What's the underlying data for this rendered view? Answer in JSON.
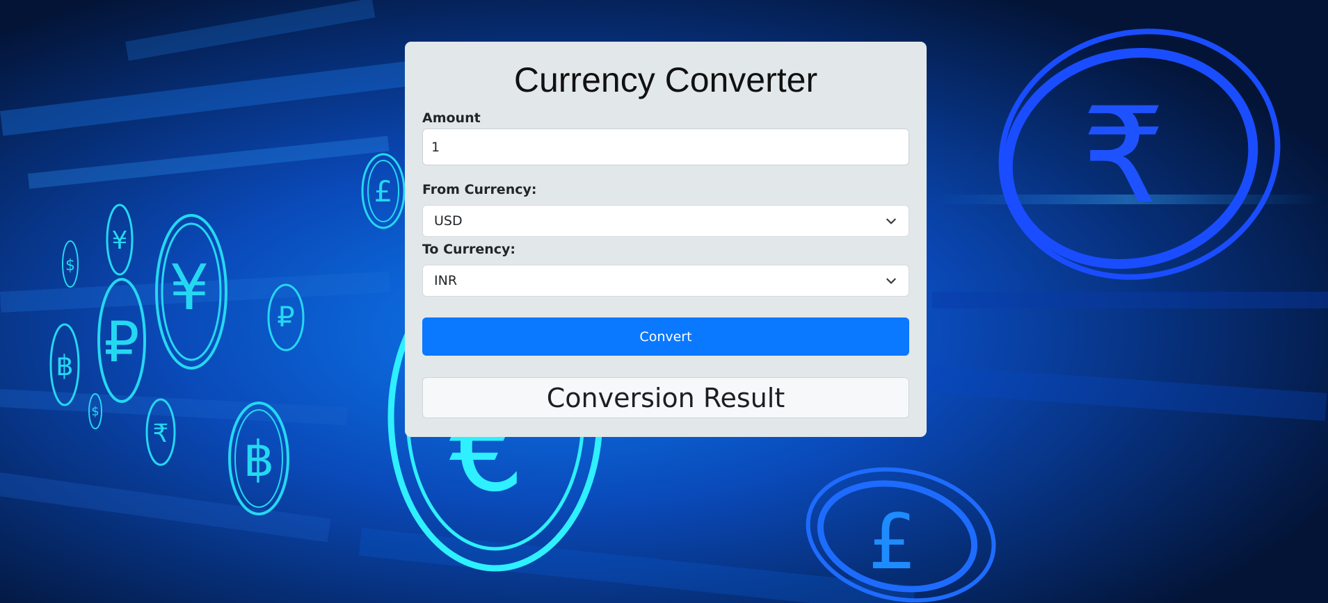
{
  "converter": {
    "title": "Currency Converter",
    "amount": {
      "label": "Amount",
      "value": "1"
    },
    "from_currency": {
      "label": "From Currency:",
      "selected": "USD"
    },
    "to_currency": {
      "label": "To Currency:",
      "selected": "INR"
    },
    "convert_label": "Convert",
    "result_heading": "Conversion Result"
  },
  "background": {
    "coin_symbols": [
      "£",
      "¥",
      "$",
      "₽",
      "฿",
      "$",
      "₹",
      "฿",
      "₽",
      "¥",
      "€",
      "£",
      "₹"
    ],
    "colors": {
      "deep": "#041a4d",
      "mid": "#0a4fd0",
      "cyan": "#1de3f5",
      "royal": "#1a4dff"
    }
  },
  "theme": {
    "card_bg": "#e2e8ea",
    "button_bg": "#0a78ff"
  }
}
